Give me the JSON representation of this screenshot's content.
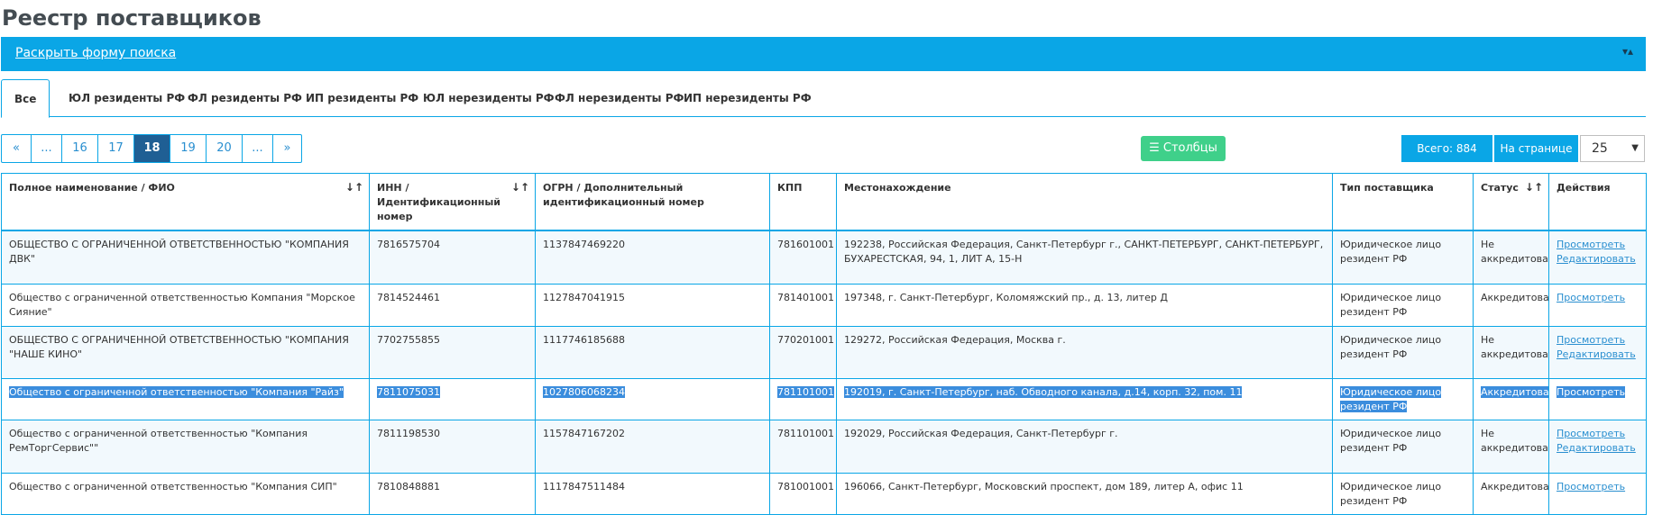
{
  "page": {
    "title": "Реестр поставщиков"
  },
  "search_bar": {
    "link": "Раскрыть форму поиска",
    "toggle_icon": "sort-icon"
  },
  "tabs": [
    {
      "label": "Все",
      "active": true
    },
    {
      "label": "ЮЛ резиденты РФ"
    },
    {
      "label": "ФЛ резиденты РФ"
    },
    {
      "label": "ИП резиденты РФ"
    },
    {
      "label": "ЮЛ нерезиденты РФ"
    },
    {
      "label": "ФЛ нерезиденты РФ"
    },
    {
      "label": "ИП нерезиденты РФ"
    }
  ],
  "pagination": {
    "first": "«",
    "ellipsis_left": "...",
    "pages": [
      "16",
      "17",
      "18",
      "19",
      "20"
    ],
    "current": "18",
    "ellipsis_right": "...",
    "last": "»"
  },
  "toolbar": {
    "columns_label": "Столбцы",
    "total_label": "Всего: 884",
    "per_page_label": "На странице",
    "per_page_value": "25"
  },
  "table": {
    "headers": [
      "Полное наименование / ФИО",
      "ИНН / Идентификационный номер",
      "ОГРН / Дополнительный идентификационный номер",
      "КПП",
      "Местонахождение",
      "Тип поставщика",
      "Статус",
      "Действия"
    ],
    "rows": [
      {
        "name": "ОБЩЕСТВО С ОГРАНИЧЕННОЙ ОТВЕТСТВЕННОСТЬЮ \"КОМПАНИЯ ДВК\"",
        "inn": "7816575704",
        "ogrn": "1137847469220",
        "kpp": "781601001",
        "address": "192238, Российская Федерация, Санкт-Петербург г., САНКТ-ПЕТЕРБУРГ, САНКТ-ПЕТЕРБУРГ, БУХАРЕСТСКАЯ, 94, 1, ЛИТ А, 15-Н",
        "type": "Юридическое лицо резидент РФ",
        "status": "Не аккредитован",
        "view": "Просмотреть",
        "edit": "Редактировать"
      },
      {
        "name": "Общество с ограниченной ответственностью Компания \"Морское Сияние\"",
        "inn": "7814524461",
        "ogrn": "1127847041915",
        "kpp": "781401001",
        "address": "197348, г. Санкт-Петербург, Коломяжский пр., д. 13, литер Д",
        "type": "Юридическое лицо резидент РФ",
        "status": "Аккредитован",
        "view": "Просмотреть",
        "edit": ""
      },
      {
        "name": "ОБЩЕСТВО С ОГРАНИЧЕННОЙ ОТВЕТСТВЕННОСТЬЮ \"КОМПАНИЯ \"НАШЕ КИНО\"",
        "inn": "7702755855",
        "ogrn": "1117746185688",
        "kpp": "770201001",
        "address": "129272, Российская Федерация, Москва г.",
        "type": "Юридическое лицо резидент РФ",
        "status": "Не аккредитован",
        "view": "Просмотреть",
        "edit": "Редактировать"
      },
      {
        "name": "Общество с ограниченной ответственностью \"Компания \"Райз\"",
        "inn": "7811075031",
        "ogrn": "1027806068234",
        "kpp": "781101001",
        "address": "192019, г. Санкт-Петербург, наб. Обводного канала, д.14, корп. 32, пом. 11",
        "type": "Юридическое лицо резидент РФ",
        "status": "Аккредитован",
        "view": "Просмотреть",
        "edit": "",
        "selected": true
      },
      {
        "name": "Общество с ограниченной ответственностью \"Компания РемТоргСервис\"\"",
        "inn": "7811198530",
        "ogrn": "1157847167202",
        "kpp": "781101001",
        "address": "192029, Российская Федерация, Санкт-Петербург г.",
        "type": "Юридическое лицо резидент РФ",
        "status": "Не аккредитован",
        "view": "Просмотреть",
        "edit": "Редактировать"
      },
      {
        "name": "Общество с ограниченной ответственностью \"Компания СИП\"",
        "inn": "7810848881",
        "ogrn": "1117847511484",
        "kpp": "781001001",
        "address": "196066, Санкт-Петербург, Московский проспект, дом 189, литер А, офис 11",
        "type": "Юридическое лицо резидент РФ",
        "status": "Аккредитован",
        "view": "Просмотреть",
        "edit": ""
      }
    ]
  },
  "colors": {
    "accent": "#0aa6e6",
    "pager_active": "#1f5f94",
    "columns_button": "#3fd08a",
    "selection": "#3b8ddd"
  }
}
